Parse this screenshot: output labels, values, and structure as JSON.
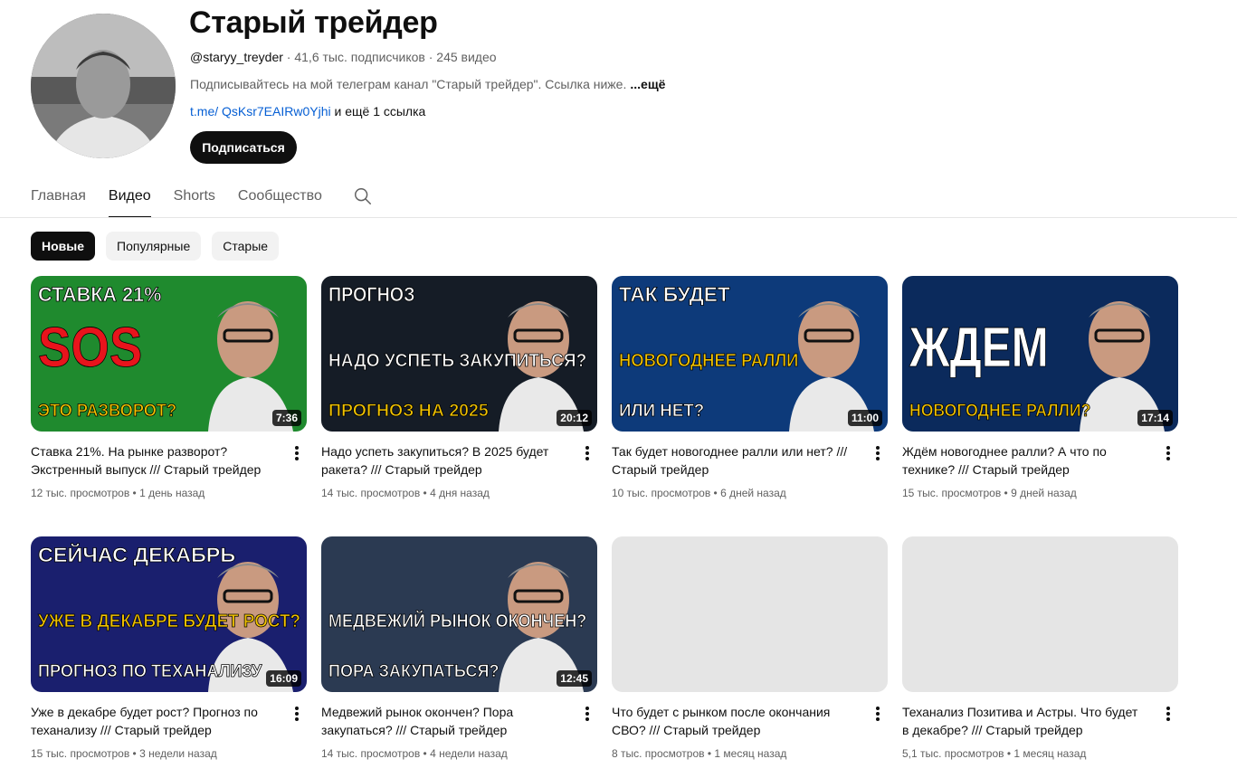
{
  "channel": {
    "title": "Старый трейдер",
    "handle": "@staryy_treyder",
    "meta_rest": " · 41,6 тыс. подписчиков · 245 видео",
    "description": "Подписывайтесь на мой телеграм канал \"Старый трейдер\". Ссылка ниже.",
    "more_label": "...ещё",
    "link_text": "t.me/ QsKsr7EAIRw0Yjhi",
    "link_suffix": " и ещё 1 ссылка",
    "subscribe_label": "Подписаться"
  },
  "tabs": [
    {
      "label": "Главная",
      "active": false
    },
    {
      "label": "Видео",
      "active": true
    },
    {
      "label": "Shorts",
      "active": false
    },
    {
      "label": "Сообщество",
      "active": false
    }
  ],
  "chips": [
    {
      "label": "Новые",
      "active": true
    },
    {
      "label": "Популярные",
      "active": false
    },
    {
      "label": "Старые",
      "active": false
    }
  ],
  "videos": [
    {
      "title": "Ставка 21%. На рынке разворот? Экстренный выпуск /// Старый трейдер",
      "meta": "12 тыс. просмотров • 1 день назад",
      "duration": "7:36",
      "thumb": {
        "bg": "#1f8a2e",
        "top": "СТАВКА 21%",
        "mid": "SOS",
        "bottom": "ЭТО РАЗВОРОТ?",
        "mid_color": "#e8141c",
        "bottom_color": "#f2c300"
      }
    },
    {
      "title": "Надо успеть закупиться? В 2025 будет ракета? /// Старый трейдер",
      "meta": "14 тыс. просмотров • 4 дня назад",
      "duration": "20:12",
      "thumb": {
        "bg": "#151c26",
        "top": "ПРОГНОЗ",
        "mid": "НАДО УСПЕТЬ ЗАКУПИТЬСЯ?",
        "bottom": "ПРОГНОЗ НА 2025",
        "mid_color": "#ffffff",
        "bottom_color": "#f2c300"
      }
    },
    {
      "title": "Так будет новогоднее ралли или нет? /// Старый трейдер",
      "meta": "10 тыс. просмотров • 6 дней назад",
      "duration": "11:00",
      "thumb": {
        "bg": "#0d3a7a",
        "top": "ТАК БУДЕТ",
        "mid": "НОВОГОДНЕЕ РАЛЛИ",
        "bottom": "ИЛИ НЕТ?",
        "mid_color": "#f2c300",
        "bottom_color": "#ffffff"
      }
    },
    {
      "title": "Ждём новогоднее ралли? А что по технике? /// Старый трейдер",
      "meta": "15 тыс. просмотров • 9 дней назад",
      "duration": "17:14",
      "thumb": {
        "bg": "#0b2a5c",
        "top": "",
        "mid": "ЖДЕМ",
        "bottom": "НОВОГОДНЕЕ РАЛЛИ?",
        "mid_color": "#ffffff",
        "bottom_color": "#f2c300"
      }
    },
    {
      "title": "Уже в декабре будет рост? Прогноз по теханализу /// Старый трейдер",
      "meta": "15 тыс. просмотров • 3 недели назад",
      "duration": "16:09",
      "thumb": {
        "bg": "#1a1f6e",
        "top": "СЕЙЧАС   ДЕКАБРЬ",
        "mid": "УЖЕ В ДЕКАБРЕ БУДЕТ РОСТ?",
        "bottom": "ПРОГНОЗ ПО ТЕХАНАЛИЗУ",
        "mid_color": "#f2c300",
        "bottom_color": "#ffffff"
      }
    },
    {
      "title": "Медвежий рынок окончен? Пора закупаться? /// Старый трейдер",
      "meta": "14 тыс. просмотров • 4 недели назад",
      "duration": "12:45",
      "thumb": {
        "bg": "#2b3a52",
        "top": "",
        "mid": "МЕДВЕЖИЙ РЫНОК ОКОНЧЕН?",
        "bottom": "ПОРА ЗАКУПАТЬСЯ?",
        "mid_color": "#ffffff",
        "bottom_color": "#ffffff"
      }
    },
    {
      "title": "Что будет с рынком после окончания СВО? /// Старый трейдер",
      "meta": "8 тыс. просмотров • 1 месяц назад",
      "duration": "",
      "thumb": null
    },
    {
      "title": "Теханализ Позитива и Астры. Что будет в декабре? /// Старый трейдер",
      "meta": "5,1 тыс. просмотров • 1 месяц назад",
      "duration": "",
      "thumb": null
    }
  ]
}
